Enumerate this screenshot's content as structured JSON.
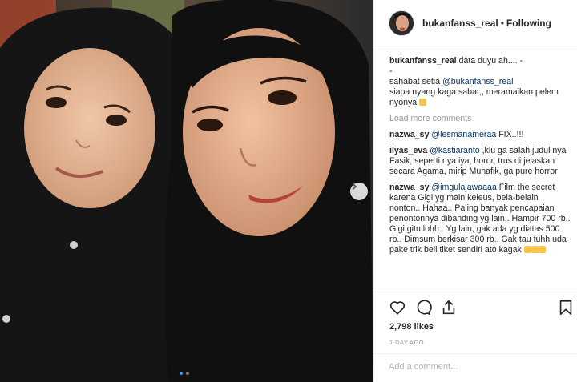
{
  "post": {
    "username": "bukanfanss_real",
    "follow_status": "Following",
    "separator": "•"
  },
  "caption": {
    "username": "bukanfanss_real",
    "line1": "data duyu ah.... -",
    "line2": "-",
    "line3_prefix": "sahabat setia ",
    "line3_mention": "@bukanfanss_real",
    "line4": "siapa nyang kaga sabar,, meramaikan pelem nyonya"
  },
  "load_more_label": "Load more comments",
  "comments": [
    {
      "username": "nazwa_sy",
      "mention": "@lesmanameraa",
      "text": " FIX..!!!"
    },
    {
      "username": "ilyas_eva",
      "mention": "@kastiaranto",
      "text": " ,klu ga salah judul nya Fasik, seperti nya iya, horor, trus di jelaskan secara Agama, mirip Munafik, ga pure horror"
    },
    {
      "username": "nazwa_sy",
      "mention": "@imgulajawaaaa",
      "text": " Film the secret karena Gigi yg main keleus, bela-belain nonton.. Hahaa.. Paling banyak pencapaian penontonnya dibanding yg lain.. Hampir 700 rb.. Gigi gitu lohh.. Yg lain, gak ada yg diatas 500 rb.. Dimsum berkisar 300 rb.. Gak tau tuhh uda pake trik beli tiket sendiri ato kagak"
    }
  ],
  "likes_text": "2,798 likes",
  "timestamp": "1 DAY AGO",
  "add_comment_placeholder": "Add a comment...",
  "colors": {
    "accent": "#3897f0",
    "mention": "#003569",
    "muted": "#999999"
  },
  "icons": {
    "like": "heart-icon",
    "comment": "comment-icon",
    "share": "share-icon",
    "save": "bookmark-icon",
    "next": "chevron-right-icon"
  },
  "carousel": {
    "total_slides": 2,
    "active_slide": 1
  }
}
